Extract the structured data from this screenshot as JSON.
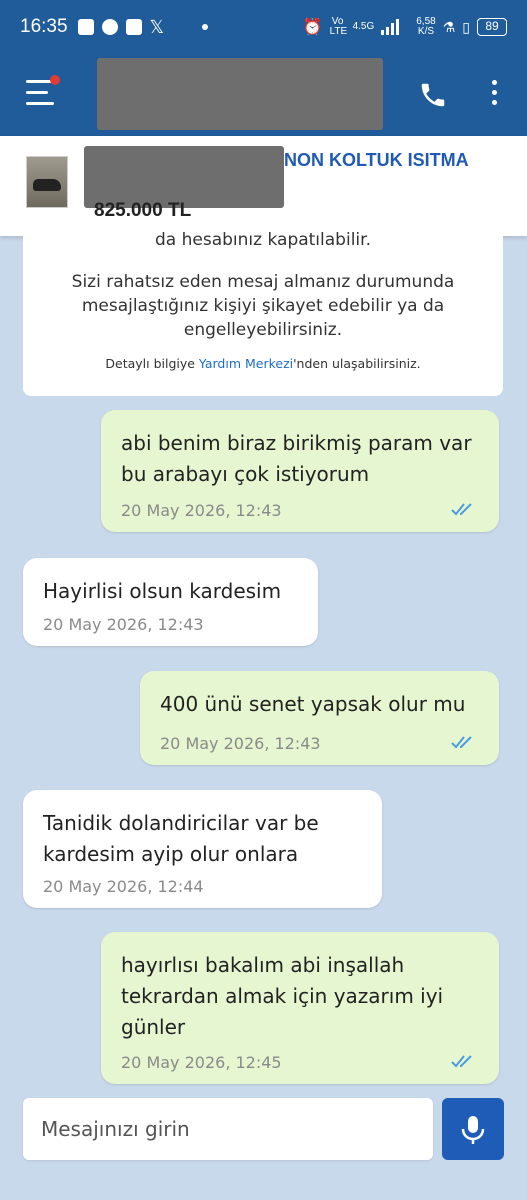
{
  "status_bar": {
    "time": "16:35",
    "network": "Vo LTE",
    "network_gen": "4.5G",
    "speed_value": "6,58",
    "speed_unit": "K/S",
    "battery": "89"
  },
  "listing": {
    "title": "NON KOLTUK ISITMA",
    "price": "825.000 TL"
  },
  "info": {
    "cut_line": "da hesabınız kapatılabilir.",
    "paragraph": "Sizi rahatsız eden mesaj almanız durumunda mesajlaştığınız kişiyi şikayet edebilir ya da engelleyebilirsiniz.",
    "detail_prefix": "Detaylı bilgiye ",
    "detail_link": "Yardım Merkezi",
    "detail_suffix": "'nden ulaşabilirsiniz."
  },
  "messages": [
    {
      "direction": "out",
      "text": "abi benim biraz birikmiş param var\nbu arabayı çok istiyorum",
      "time": "20 May 2026, 12:43"
    },
    {
      "direction": "in",
      "text": "Hayirlisi olsun kardesim",
      "time": "20 May 2026, 12:43"
    },
    {
      "direction": "out",
      "text": "400 ünü senet yapsak olur mu",
      "time": "20 May 2026, 12:43"
    },
    {
      "direction": "in",
      "text": "Tanidik dolandiricilar var be\nkardesim ayip olur onlara",
      "time": "20 May 2026, 12:44"
    },
    {
      "direction": "out",
      "text": "hayırlısı bakalım abi inşallah\ntekrardan almak için yazarım iyi\ngünler",
      "time": "20 May 2026, 12:45"
    }
  ],
  "composer": {
    "placeholder": "Mesajınızı girin"
  },
  "colors": {
    "header": "#1f5c99",
    "background": "#c9d9ec",
    "outgoing": "#e6f6d0",
    "incoming": "#ffffff",
    "tick": "#4a9de0",
    "mic": "#1f5cb8"
  }
}
